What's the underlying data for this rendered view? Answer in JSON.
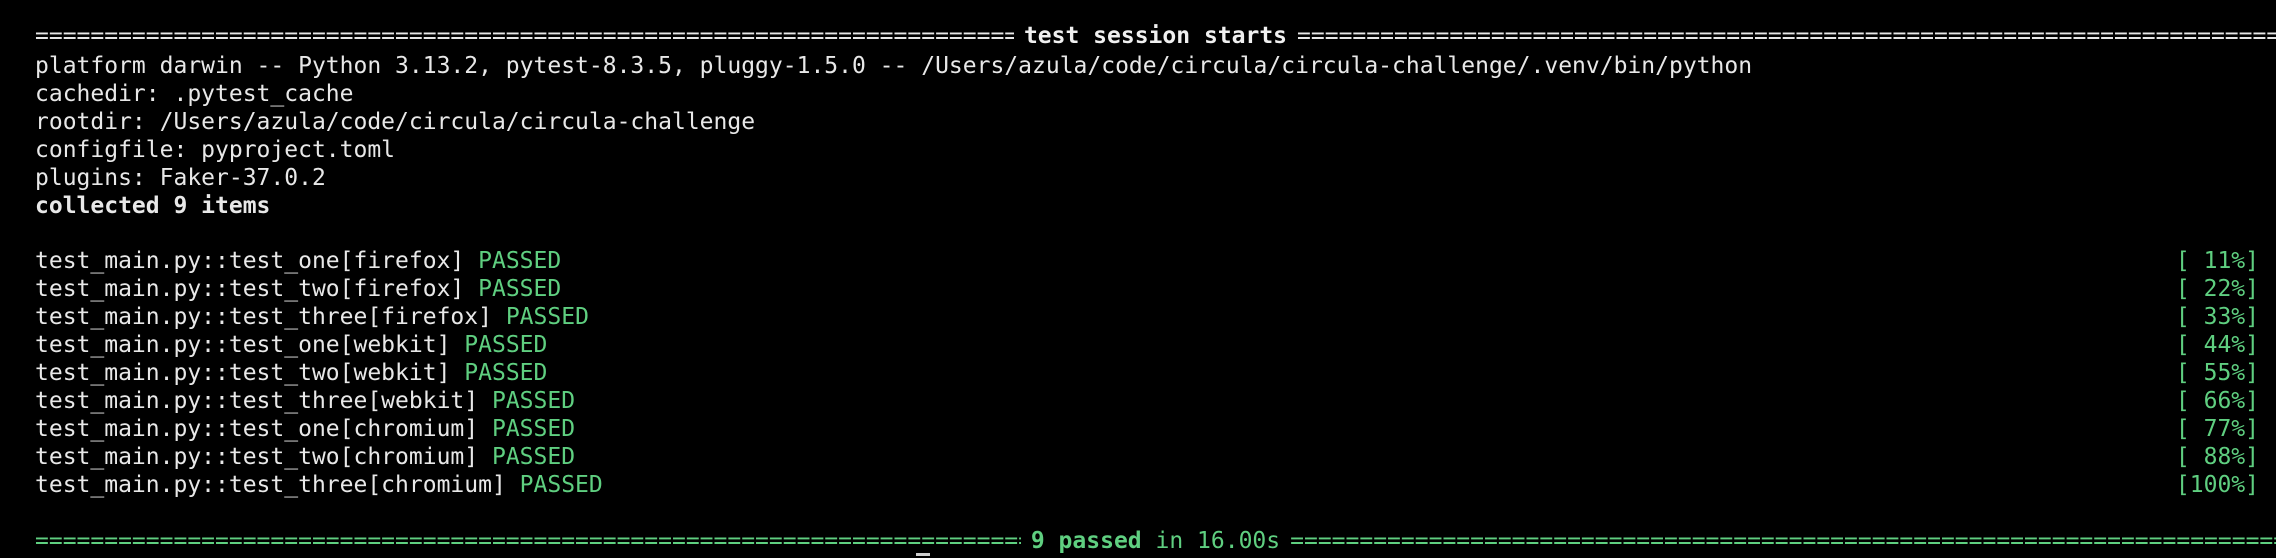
{
  "header": {
    "rule_char": "=",
    "title": "test session starts"
  },
  "info": {
    "platform": "platform darwin -- Python 3.13.2, pytest-8.3.5, pluggy-1.5.0 -- /Users/azula/code/circula/circula-challenge/.venv/bin/python",
    "cachedir": "cachedir: .pytest_cache",
    "rootdir": "rootdir: /Users/azula/code/circula/circula-challenge",
    "configfile": "configfile: pyproject.toml",
    "plugins": "plugins: Faker-37.0.2",
    "collected": "collected 9 items"
  },
  "tests": [
    {
      "name": "test_main.py::test_one[firefox]",
      "status": "PASSED",
      "progress": "[ 11%]"
    },
    {
      "name": "test_main.py::test_two[firefox]",
      "status": "PASSED",
      "progress": "[ 22%]"
    },
    {
      "name": "test_main.py::test_three[firefox]",
      "status": "PASSED",
      "progress": "[ 33%]"
    },
    {
      "name": "test_main.py::test_one[webkit]",
      "status": "PASSED",
      "progress": "[ 44%]"
    },
    {
      "name": "test_main.py::test_two[webkit]",
      "status": "PASSED",
      "progress": "[ 55%]"
    },
    {
      "name": "test_main.py::test_three[webkit]",
      "status": "PASSED",
      "progress": "[ 66%]"
    },
    {
      "name": "test_main.py::test_one[chromium]",
      "status": "PASSED",
      "progress": "[ 77%]"
    },
    {
      "name": "test_main.py::test_two[chromium]",
      "status": "PASSED",
      "progress": "[ 88%]"
    },
    {
      "name": "test_main.py::test_three[chromium]",
      "status": "PASSED",
      "progress": "[100%]"
    }
  ],
  "summary": {
    "passed": "9 passed",
    "duration": "in 16.00s"
  },
  "colors": {
    "background": "#000000",
    "text": "#e8e8e8",
    "passed_green": "#5fcf80"
  }
}
